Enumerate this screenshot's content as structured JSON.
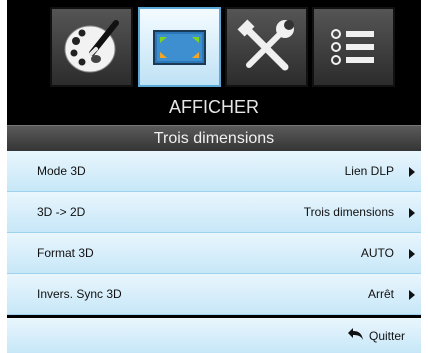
{
  "menu": {
    "tabs": [
      {
        "name": "palette",
        "selected": false
      },
      {
        "name": "display",
        "selected": true
      },
      {
        "name": "tools",
        "selected": false
      },
      {
        "name": "list",
        "selected": false
      }
    ],
    "title": "AFFICHER",
    "subtitle": "Trois dimensions",
    "items": [
      {
        "label": "Mode 3D",
        "value": "Lien DLP"
      },
      {
        "label": "3D -> 2D",
        "value": "Trois dimensions"
      },
      {
        "label": "Format 3D",
        "value": "AUTO"
      },
      {
        "label": "Invers. Sync 3D",
        "value": "Arrêt"
      }
    ],
    "quit_label": "Quitter"
  },
  "colors": {
    "row_top": "#e9f6fd",
    "row_bottom": "#c7e7f8",
    "selected_tab_border": "#5aa9d6"
  }
}
